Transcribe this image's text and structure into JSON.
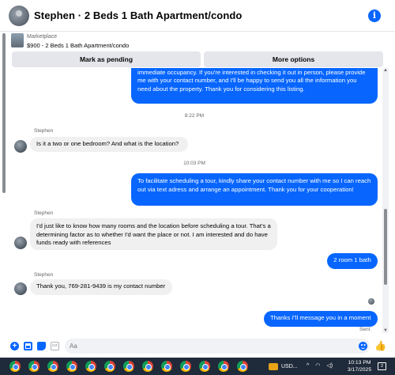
{
  "header": {
    "title": "Stephen · 2 Beds 1 Bath Apartment/condo",
    "info_icon": "info-icon"
  },
  "listing": {
    "kicker": "Marketplace",
    "price_title": "$900 - 2 Beds 1 Bath Apartment/condo"
  },
  "actions": {
    "pending_label": "Mark as pending",
    "more_label": "More options"
  },
  "messages": [
    {
      "direction": "out",
      "text": "Hello there! This wonderful house is currently available for rent and is ready for immediate occupancy. If you're interested in checking it out in person, please provide me with your contact number, and I'll be happy to send you all the information you need about the property. Thank you for considering this listing."
    },
    {
      "direction": "in",
      "sender": "Stephen",
      "text": "Is it a two or one bedroom? And what is the location?"
    },
    {
      "direction": "out",
      "text": "To facilitate scheduling a tour, kindly share your contact number with me so I can reach out via text adress and arrange an appointment. Thank you for your cooperation!"
    },
    {
      "direction": "in",
      "sender": "Stephen",
      "text": "I'd just like to know how many rooms and the location before scheduling a tour. That's a determining factor as to whether I'd want the place or not. I am interested and do have funds ready with references"
    },
    {
      "direction": "out",
      "text": "2 room 1 bath"
    },
    {
      "direction": "in",
      "sender": "Stephen",
      "text": "Thank you, 769-281-9439 is my contact number"
    },
    {
      "direction": "out",
      "text": "Thanks i\"ll message you in a moment"
    }
  ],
  "timestamps": [
    "8:22 PM",
    "10:03 PM"
  ],
  "sent_label": "Sent",
  "composer": {
    "placeholder": "Aa",
    "plus_glyph": "+",
    "gif_glyph": "GIF",
    "like_glyph": "👍",
    "icons": [
      "plus-icon",
      "photo-icon",
      "sticker-icon",
      "gif-icon",
      "emoji-icon",
      "like-icon"
    ]
  },
  "taskbar": {
    "currency": "USD...",
    "tray_caret": "^",
    "tray_wifi": "◠",
    "tray_volume": "◁)",
    "time": "10:13 PM",
    "date": "3/17/2025",
    "notifications": "2"
  },
  "colors": {
    "accent": "#0866ff",
    "incoming_bubble": "#f0f0f0",
    "taskbar": "#1f2a3a"
  }
}
